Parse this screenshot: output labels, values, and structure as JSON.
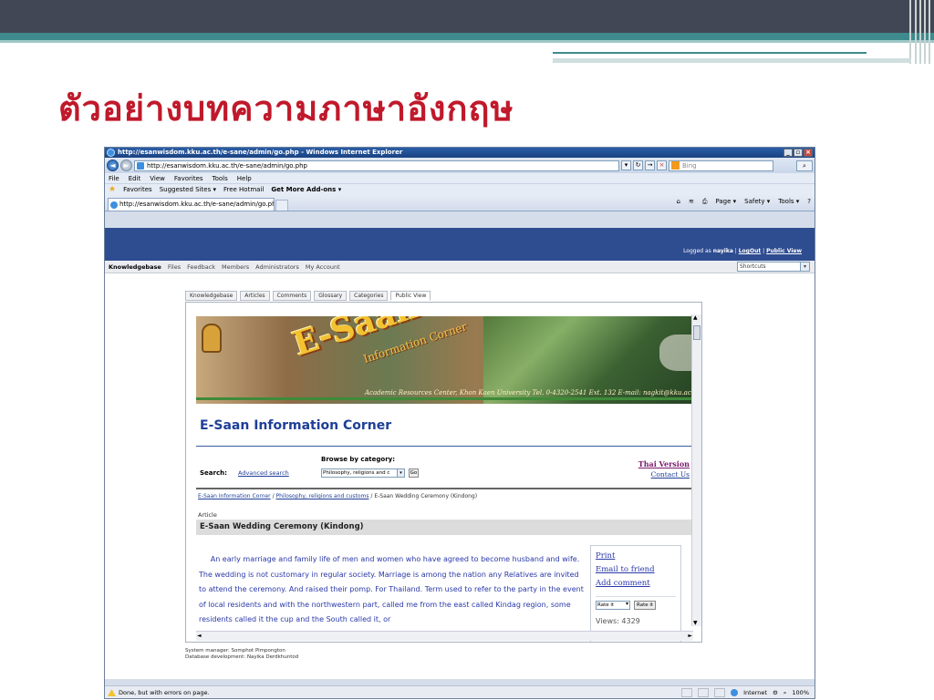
{
  "slide": {
    "title": "ตัวอย่างบทความภาษาอังกฤษ"
  },
  "browser": {
    "window_title": "http://esanwisdom.kku.ac.th/e-sane/admin/go.php - Windows Internet Explorer",
    "address_url": "http://esanwisdom.kku.ac.th/e-sane/admin/go.php",
    "search_placeholder": "Bing",
    "menu": [
      "File",
      "Edit",
      "View",
      "Favorites",
      "Tools",
      "Help"
    ],
    "favorites_label": "Favorites",
    "favorites_items": [
      "Suggested Sites ▾",
      "Free Hotmail",
      "Get More Add-ons ▾"
    ],
    "tab_label": "http://esanwisdom.kku.ac.th/e-sane/admin/go.php",
    "command_bar": [
      "Page ▾",
      "Safety ▾",
      "Tools ▾"
    ],
    "status_text": "Done, but with errors on page.",
    "status_zone": "Internet",
    "status_zoom": "100%"
  },
  "kb": {
    "logged_in_prefix": "Logged as",
    "user": "nayika",
    "logout": "LogOut",
    "public_view_link": "Public View",
    "nav": [
      "Knowledgebase",
      "Files",
      "Feedback",
      "Members",
      "Administrators",
      "My Account"
    ],
    "shortcuts": "Shortcuts",
    "tabs": [
      "Knowledgebase",
      "Articles",
      "Comments",
      "Glossary",
      "Categories",
      "Public View"
    ]
  },
  "banner": {
    "title": "E-Saan",
    "subtitle": "Information Corner",
    "address": "Academic Resources Center, Khon Kaen University Tel. 0-4320-2541 Ext. 132 E-mail: nagkit@kku.ac.th"
  },
  "site": {
    "heading": "E-Saan Information Corner",
    "browse_label": "Browse by category:",
    "search_label": "Search:",
    "advanced_search": "Advanced search",
    "category_value": "Philosophy, religions and c",
    "go_button": "Go",
    "thai_version": "Thai Version",
    "contact_us": "Contact Us",
    "breadcrumb_1": "E-Saan Information Corner",
    "breadcrumb_2": "Philosophy, religions and customs",
    "breadcrumb_3": "E-Saan Wedding Ceremony (Kindong)",
    "article_label": "Article",
    "article_title": "E-Saan Wedding Ceremony (Kindong)",
    "article_body": "An early marriage and family life of men and women who have agreed to become husband and wife. The wedding is not customary in regular society. Marriage is among the nation any Relatives are invited to attend the ceremony. And raised their pomp. For Thailand. Term used to refer to the party in the event of local residents and with the northwestern part, called me from the east called Kindag region, some residents called it the cup and the South called it, or",
    "side_links": [
      "Print",
      "Email to friend",
      "Add comment"
    ],
    "rate_select": "Rate it",
    "rate_button": "Rate it",
    "views": "Views: 4329",
    "footer_1": "System manager: Somphot Pimpongton",
    "footer_2": "Database development: Nayika Derdkhuntod"
  }
}
